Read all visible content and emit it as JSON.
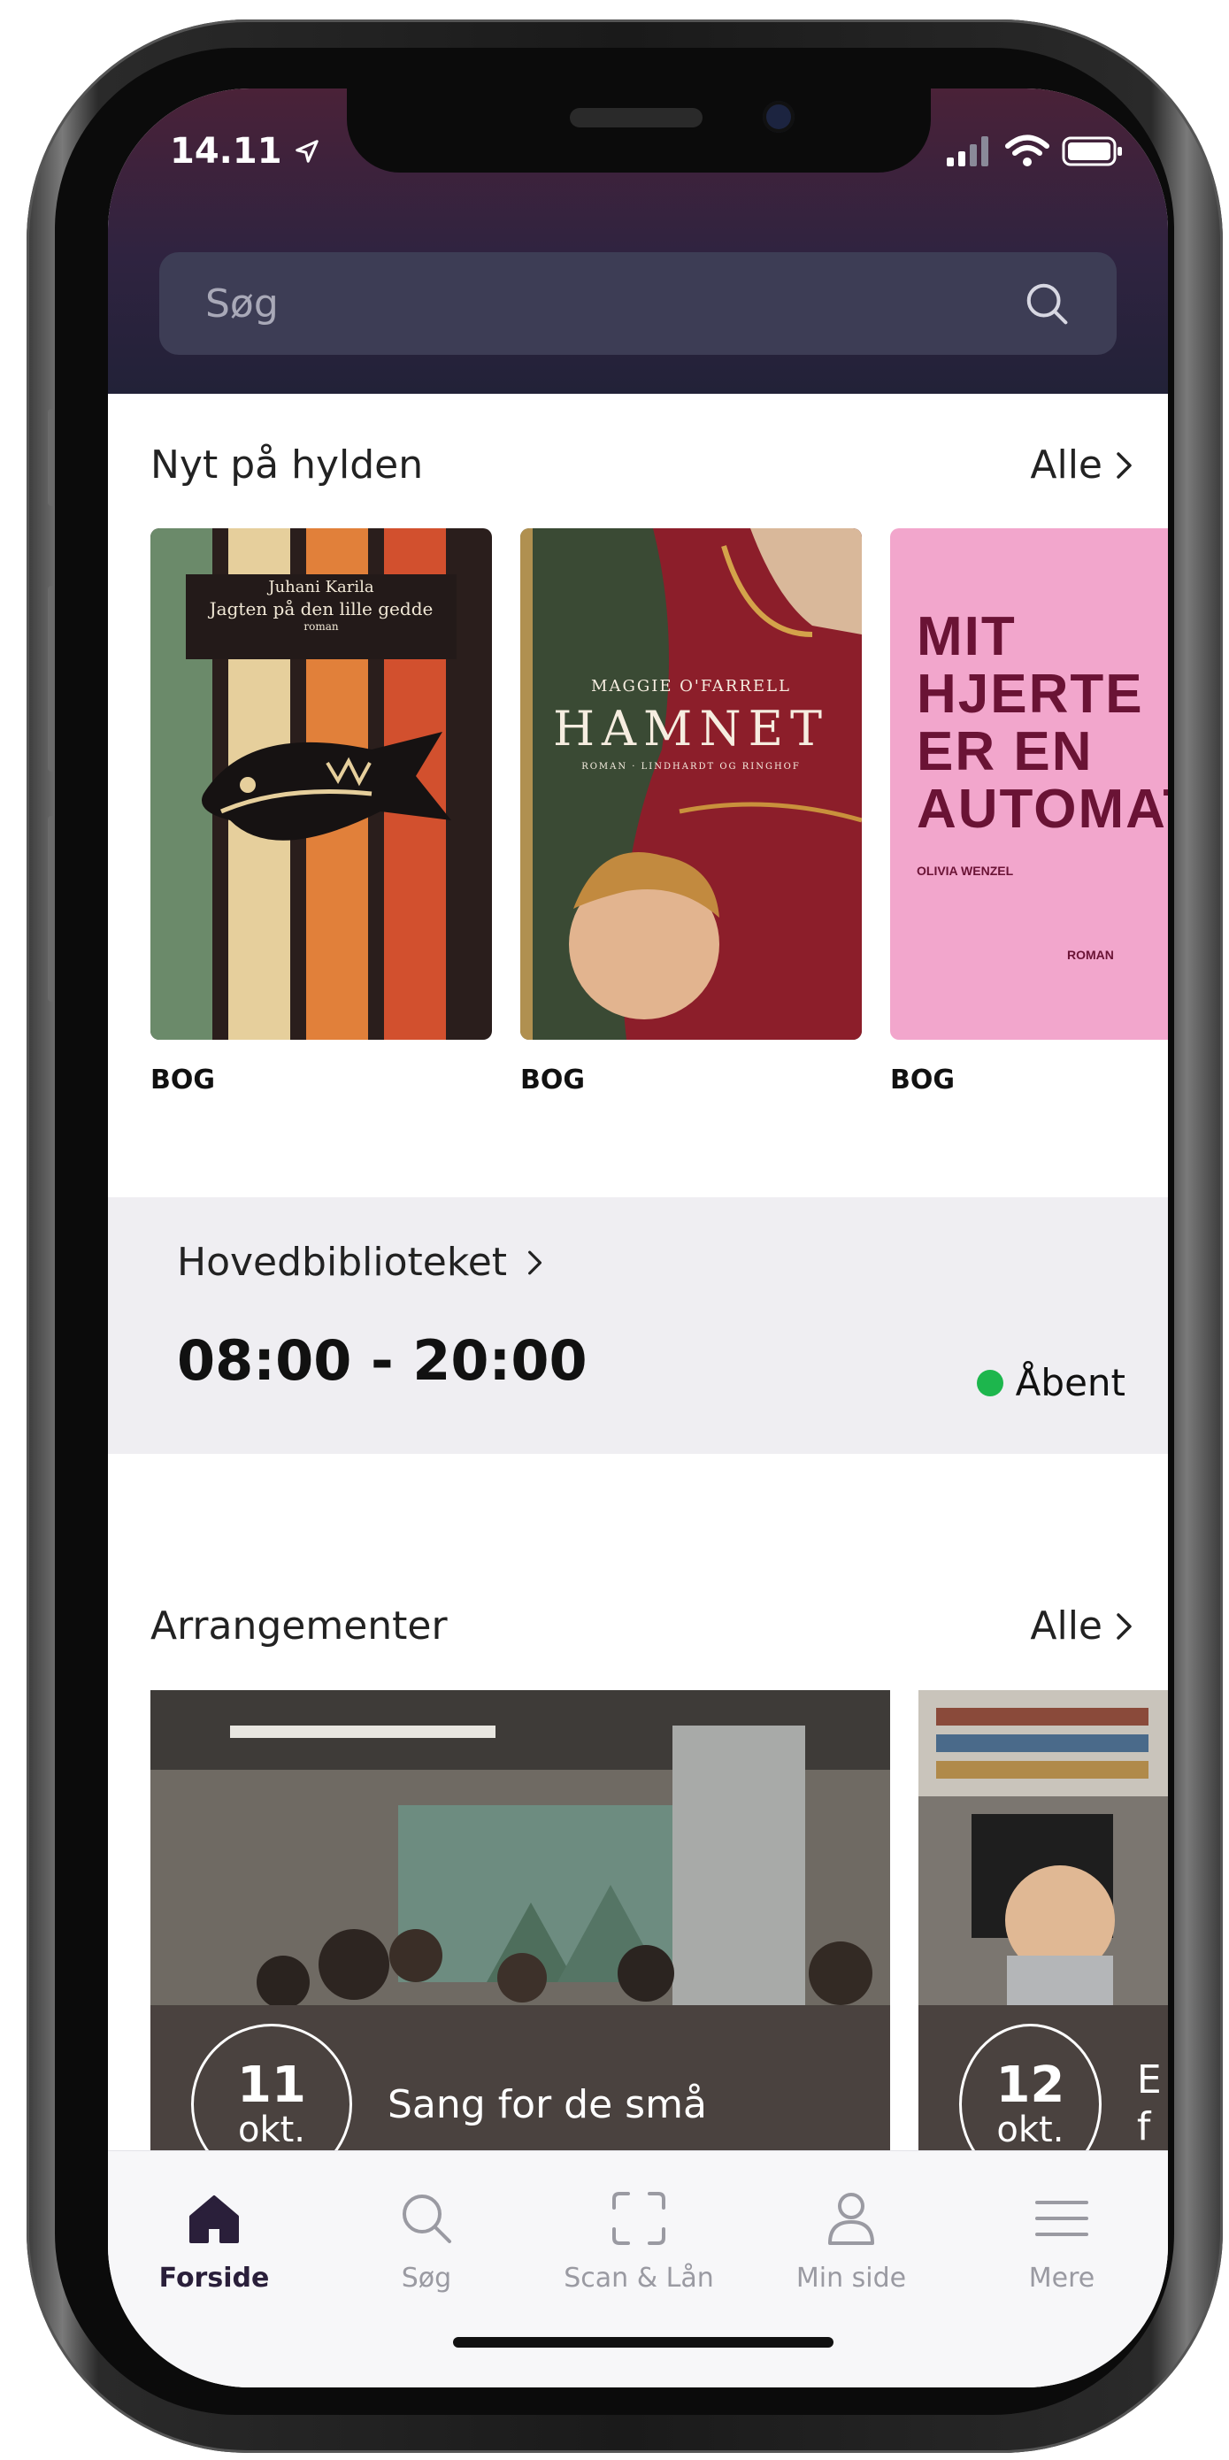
{
  "status": {
    "time": "14.11"
  },
  "search": {
    "placeholder": "Søg"
  },
  "new_on_shelf": {
    "title": "Nyt på hylden",
    "all_label": "Alle",
    "books": [
      {
        "type": "BOG",
        "cover_author": "Juhani Karila",
        "cover_title": "Jagten på den lille gedde",
        "cover_sub": "roman"
      },
      {
        "type": "BOG",
        "cover_author": "MAGGIE O'FARRELL",
        "cover_title": "HAMNET",
        "cover_sub": "ROMAN · LINDHARDT OG RINGHOF"
      },
      {
        "type": "BOG",
        "cover_author": "OLIVIA WENZEL",
        "cover_title": "MIT HJERTE ER EN AUTOMAT",
        "cover_sub": "ROMAN"
      }
    ]
  },
  "library": {
    "name": "Hovedbiblioteket",
    "hours": "08:00 - 20:00",
    "status": "Åbent",
    "status_color": "#1db64d"
  },
  "events": {
    "title": "Arrangementer",
    "all_label": "Alle",
    "items": [
      {
        "day": "11",
        "month": "okt.",
        "title": "Sang for de små"
      },
      {
        "day": "12",
        "month": "okt.",
        "title": "E f"
      }
    ]
  },
  "tabs": [
    {
      "label": "Forside",
      "icon": "home-icon",
      "active": true
    },
    {
      "label": "Søg",
      "icon": "search-icon",
      "active": false
    },
    {
      "label": "Scan & Lån",
      "icon": "scan-icon",
      "active": false
    },
    {
      "label": "Min side",
      "icon": "person-icon",
      "active": false
    },
    {
      "label": "Mere",
      "icon": "menu-icon",
      "active": false
    }
  ],
  "colors": {
    "header_top": "#4a2238",
    "header_bottom": "#222238",
    "accent": "#2a1f3a"
  }
}
